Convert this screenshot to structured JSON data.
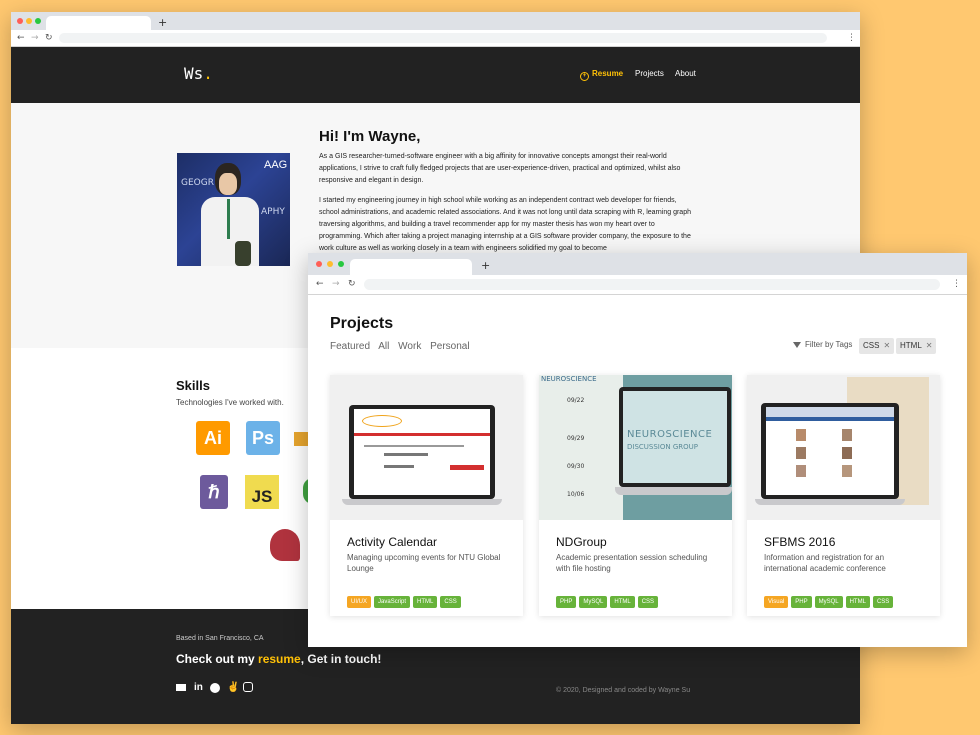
{
  "back_window": {
    "site": {
      "logo": "Ws",
      "logo_dot": ".",
      "nav": {
        "resume": "Resume",
        "projects": "Projects",
        "about": "About"
      }
    },
    "hero": {
      "greeting": "Hi! I'm Wayne,",
      "p1": "As a GIS researcher-turned-software engineer with a big affinity for innovative concepts amongst their real-world applications, I strive to craft fully fledged projects that are user-experience-driven, practical and optimized, whilst also responsive and elegant in design.",
      "p2": "I started my engineering journey in high school while working as an independent contract web developer for friends, school administrations, and academic related associations. And it was not long until data scraping with R, learning graph traversing algorithms, and building a travel recommender app for my master thesis has won my heart over to programming. Which after taking a project managing internship at a GIS software provider company, the exposure to the work culture as well as working closely in a team with engineers solidified my goal to become",
      "photo": {
        "badge_text": "AAG",
        "caption1": "GEOGR",
        "caption2": "APHY"
      }
    },
    "skills": {
      "title": "Skills",
      "subtitle": "Technologies I've worked with.",
      "icons": [
        {
          "label": "Ai",
          "name": "illustrator"
        },
        {
          "label": "Ps",
          "name": "photoshop"
        },
        {
          "label": "JS",
          "name": "javascript"
        }
      ]
    },
    "footer": {
      "based": "Based in San Francisco, CA",
      "cta_prefix": "Check out my ",
      "cta_link": "resume",
      "cta_suffix": ", Get in touch!",
      "social": [
        "mail",
        "linkedin",
        "github",
        "angellist",
        "instagram"
      ],
      "social_glyphs": {
        "linkedin": "in"
      },
      "copyright": "© 2020, Designed and coded by Wayne Su"
    }
  },
  "front_window": {
    "title": "Projects",
    "filters": [
      "Featured",
      "All",
      "Work",
      "Personal"
    ],
    "filter_by_label": "Filter by Tags",
    "active_tags": [
      "CSS",
      "HTML"
    ],
    "cards": [
      {
        "title": "Activity Calendar",
        "desc": "Managing upcoming events for NTU Global Lounge",
        "tags": [
          {
            "label": "UI/UX",
            "color": "orange"
          },
          {
            "label": "JavaScript",
            "color": "green"
          },
          {
            "label": "HTML",
            "color": "green"
          },
          {
            "label": "CSS",
            "color": "green"
          }
        ]
      },
      {
        "title": "NDGroup",
        "desc": "Academic presentation session scheduling with file hosting",
        "screen_title": "NEUROSCIENCE",
        "screen_subtitle": "DISCUSSION GROUP",
        "dates": [
          "09/22",
          "09/29",
          "09/30",
          "10/06"
        ],
        "tags": [
          {
            "label": "PHP",
            "color": "green"
          },
          {
            "label": "MySQL",
            "color": "green"
          },
          {
            "label": "HTML",
            "color": "green"
          },
          {
            "label": "CSS",
            "color": "green"
          }
        ]
      },
      {
        "title": "SFBMS 2016",
        "desc": "Information and registration for an international academic conference",
        "tags": [
          {
            "label": "Visual",
            "color": "orange"
          },
          {
            "label": "PHP",
            "color": "green"
          },
          {
            "label": "MySQL",
            "color": "green"
          },
          {
            "label": "HTML",
            "color": "green"
          },
          {
            "label": "CSS",
            "color": "green"
          }
        ]
      }
    ]
  },
  "colors": {
    "background": "#FFC870",
    "accent": "#ffc107",
    "dark": "#222222",
    "tag_green": "#67b33a",
    "tag_orange": "#f5a623"
  }
}
